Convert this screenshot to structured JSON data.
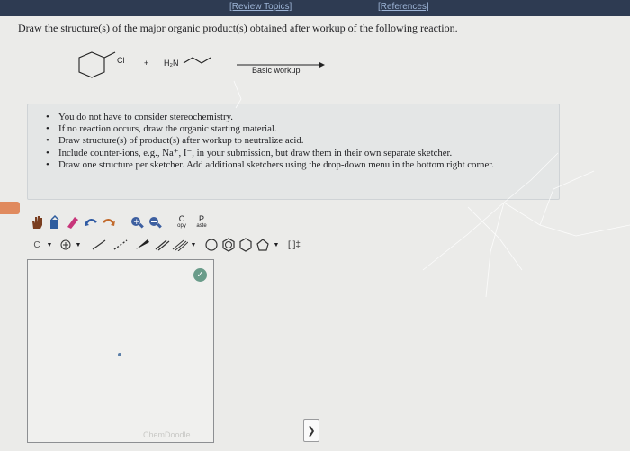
{
  "header": {
    "review_topics": "[Review Topics]",
    "references": "[References]"
  },
  "question": "Draw the structure(s) of the major organic product(s) obtained after workup of the following reaction.",
  "scheme": {
    "leaving_group": "Cl",
    "plus": "+",
    "amine": "H₂N",
    "condition": "Basic workup"
  },
  "instructions": [
    "You do not have to consider stereochemistry.",
    "If no reaction occurs, draw the organic starting material.",
    "Draw structure(s) of product(s) after workup to neutralize acid.",
    "Include counter-ions, e.g., Na⁺, I⁻, in your submission, but draw them in their own separate sketcher.",
    "Draw one structure per sketcher. Add additional sketchers using the drop-down menu in the bottom right corner."
  ],
  "toolbar": {
    "copy_label": "C",
    "copy_sub": "opy",
    "paste_label": "P",
    "paste_sub": "aste",
    "element_label": "C",
    "bracket_label": "[ ]‡"
  },
  "sketcher": {
    "brand": "ChemDoodle"
  },
  "dropdown_glyph": "❯"
}
